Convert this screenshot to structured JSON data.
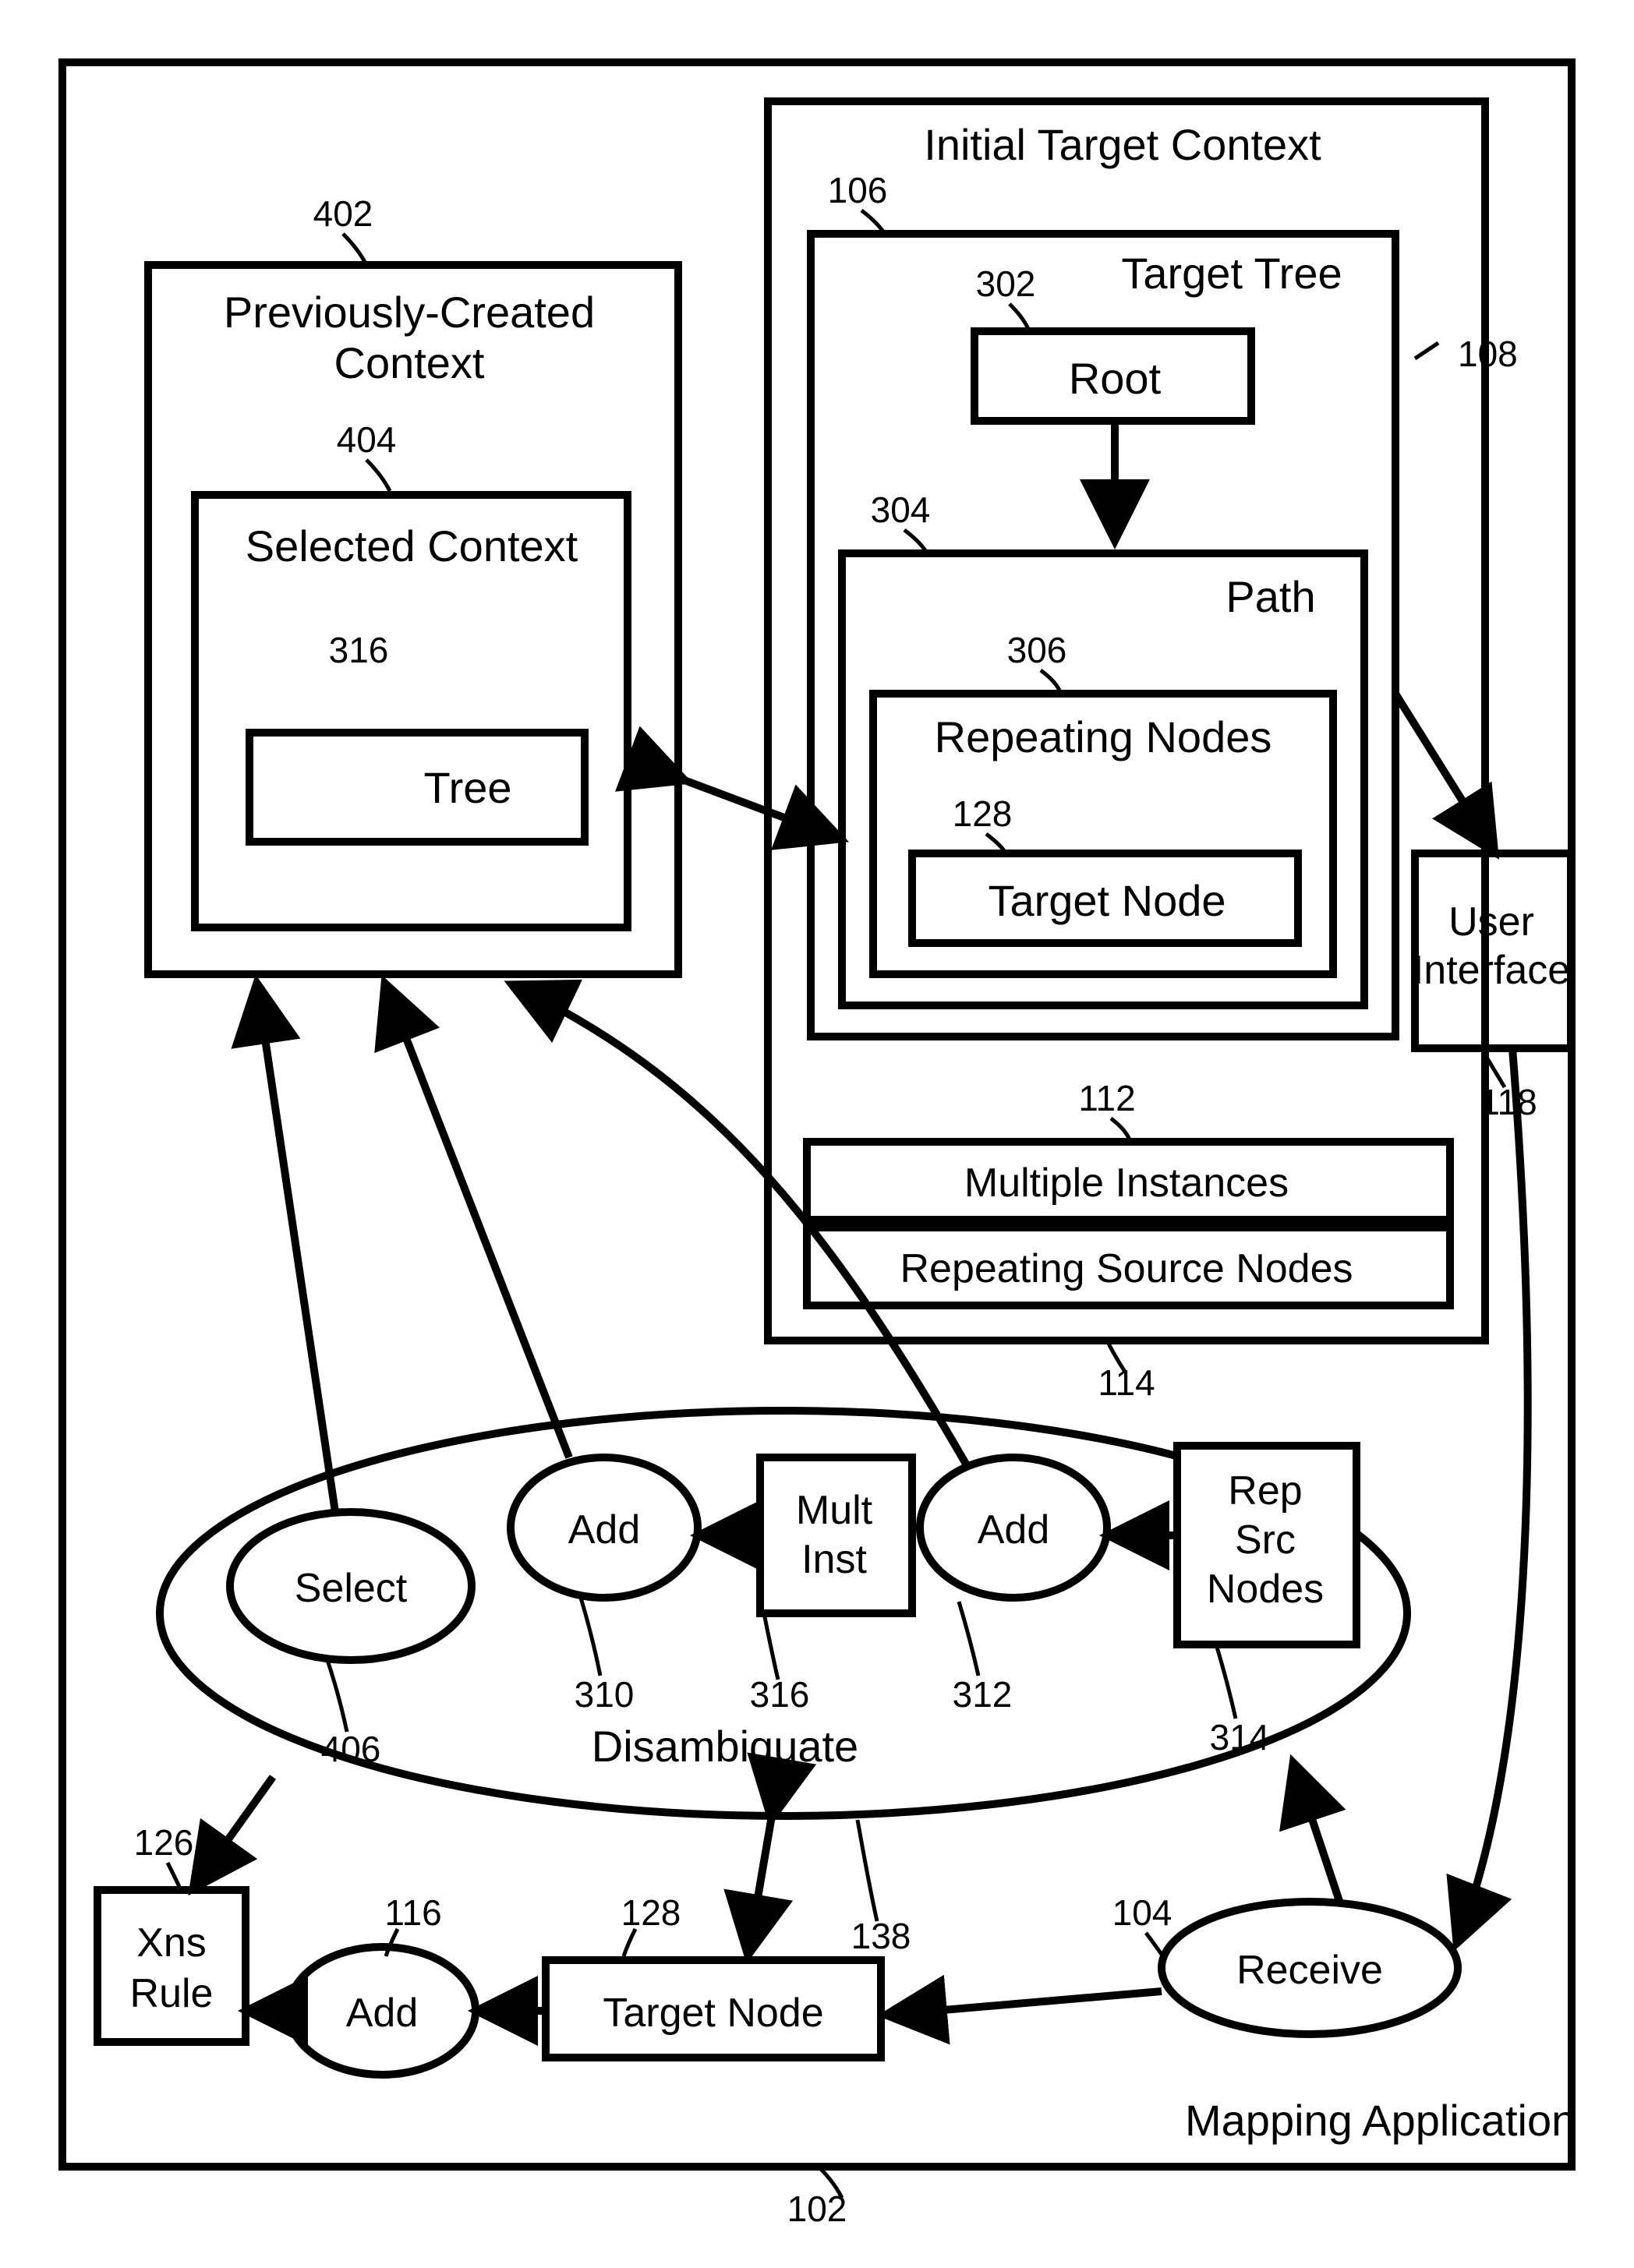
{
  "outer": {
    "title": "Mapping Application",
    "ref": "102"
  },
  "prev_context": {
    "title": "Previously-Created Context",
    "ref": "402"
  },
  "selected_context": {
    "title": "Selected Context",
    "ref": "404",
    "inner_ref": "316",
    "inner_label": "Tree"
  },
  "init_context": {
    "title": "Initial Target Context",
    "ref": "106"
  },
  "target_tree": {
    "title": "Target Tree",
    "ref": "108"
  },
  "root": {
    "label": "Root",
    "ref": "302"
  },
  "path": {
    "title": "Path",
    "ref": "304"
  },
  "repeating_nodes": {
    "title": "Repeating Nodes",
    "ref": "306"
  },
  "target_node_inner": {
    "label": "Target Node",
    "ref": "128"
  },
  "mult_inst_row": {
    "label": "Multiple Instances",
    "ref": "112"
  },
  "rep_src_row": {
    "label": "Repeating Source Nodes",
    "ref": "114"
  },
  "ui": {
    "label1": "User",
    "label2": "Interface",
    "ref": "118"
  },
  "disambiguate": {
    "label": "Disambiguate",
    "ref": "138"
  },
  "select": {
    "label": "Select",
    "ref": "406"
  },
  "add1": {
    "label": "Add",
    "ref": "310"
  },
  "mult_inst": {
    "label1": "Mult",
    "label2": "Inst",
    "ref": "316"
  },
  "add2": {
    "label": "Add",
    "ref": "312"
  },
  "rep_src_nodes": {
    "label1": "Rep",
    "label2": "Src",
    "label3": "Nodes",
    "ref": "314"
  },
  "xns_rule": {
    "label1": "Xns",
    "label2": "Rule",
    "ref": "126"
  },
  "add3": {
    "label": "Add",
    "ref": "116"
  },
  "target_node_bottom": {
    "label": "Target Node",
    "ref": "128"
  },
  "receive": {
    "label": "Receive",
    "ref": "104"
  }
}
